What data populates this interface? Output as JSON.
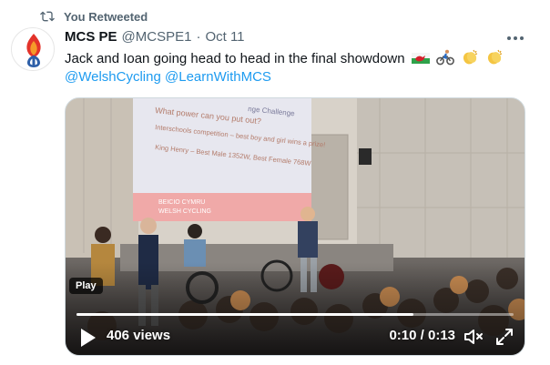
{
  "retweet": {
    "label": "You Retweeted",
    "icon": "retweet-icon"
  },
  "tweet": {
    "author_name": "MCS PE",
    "handle": "@MCSPE1",
    "separator": "·",
    "date": "Oct 11",
    "text": "Jack and Ioan going head to head in the final showdown",
    "emojis": [
      "welsh-flag-icon",
      "cyclist-icon",
      "clapping-hands-icon",
      "clapping-hands-icon"
    ],
    "mentions": [
      "@WelshCycling",
      "@LearnWithMCS"
    ]
  },
  "video": {
    "badge": "Play",
    "views": "406 views",
    "time": "0:10 / 0:13",
    "progress": 0.77,
    "slide_lines": [
      "What power can you put out?",
      "Interschools competition – best boy and girl wins a prize!",
      "King Henry – Best Male 1352W, Best Female 768W"
    ],
    "slide_title_fragment": "nge Challenge",
    "slide_logo": [
      "BEICIO CYMRU",
      "WELSH CYCLING"
    ]
  },
  "colors": {
    "link": "#1d9bf0",
    "muted": "#536471",
    "text": "#0f1419",
    "slide_pink": "#f0a9a8"
  }
}
